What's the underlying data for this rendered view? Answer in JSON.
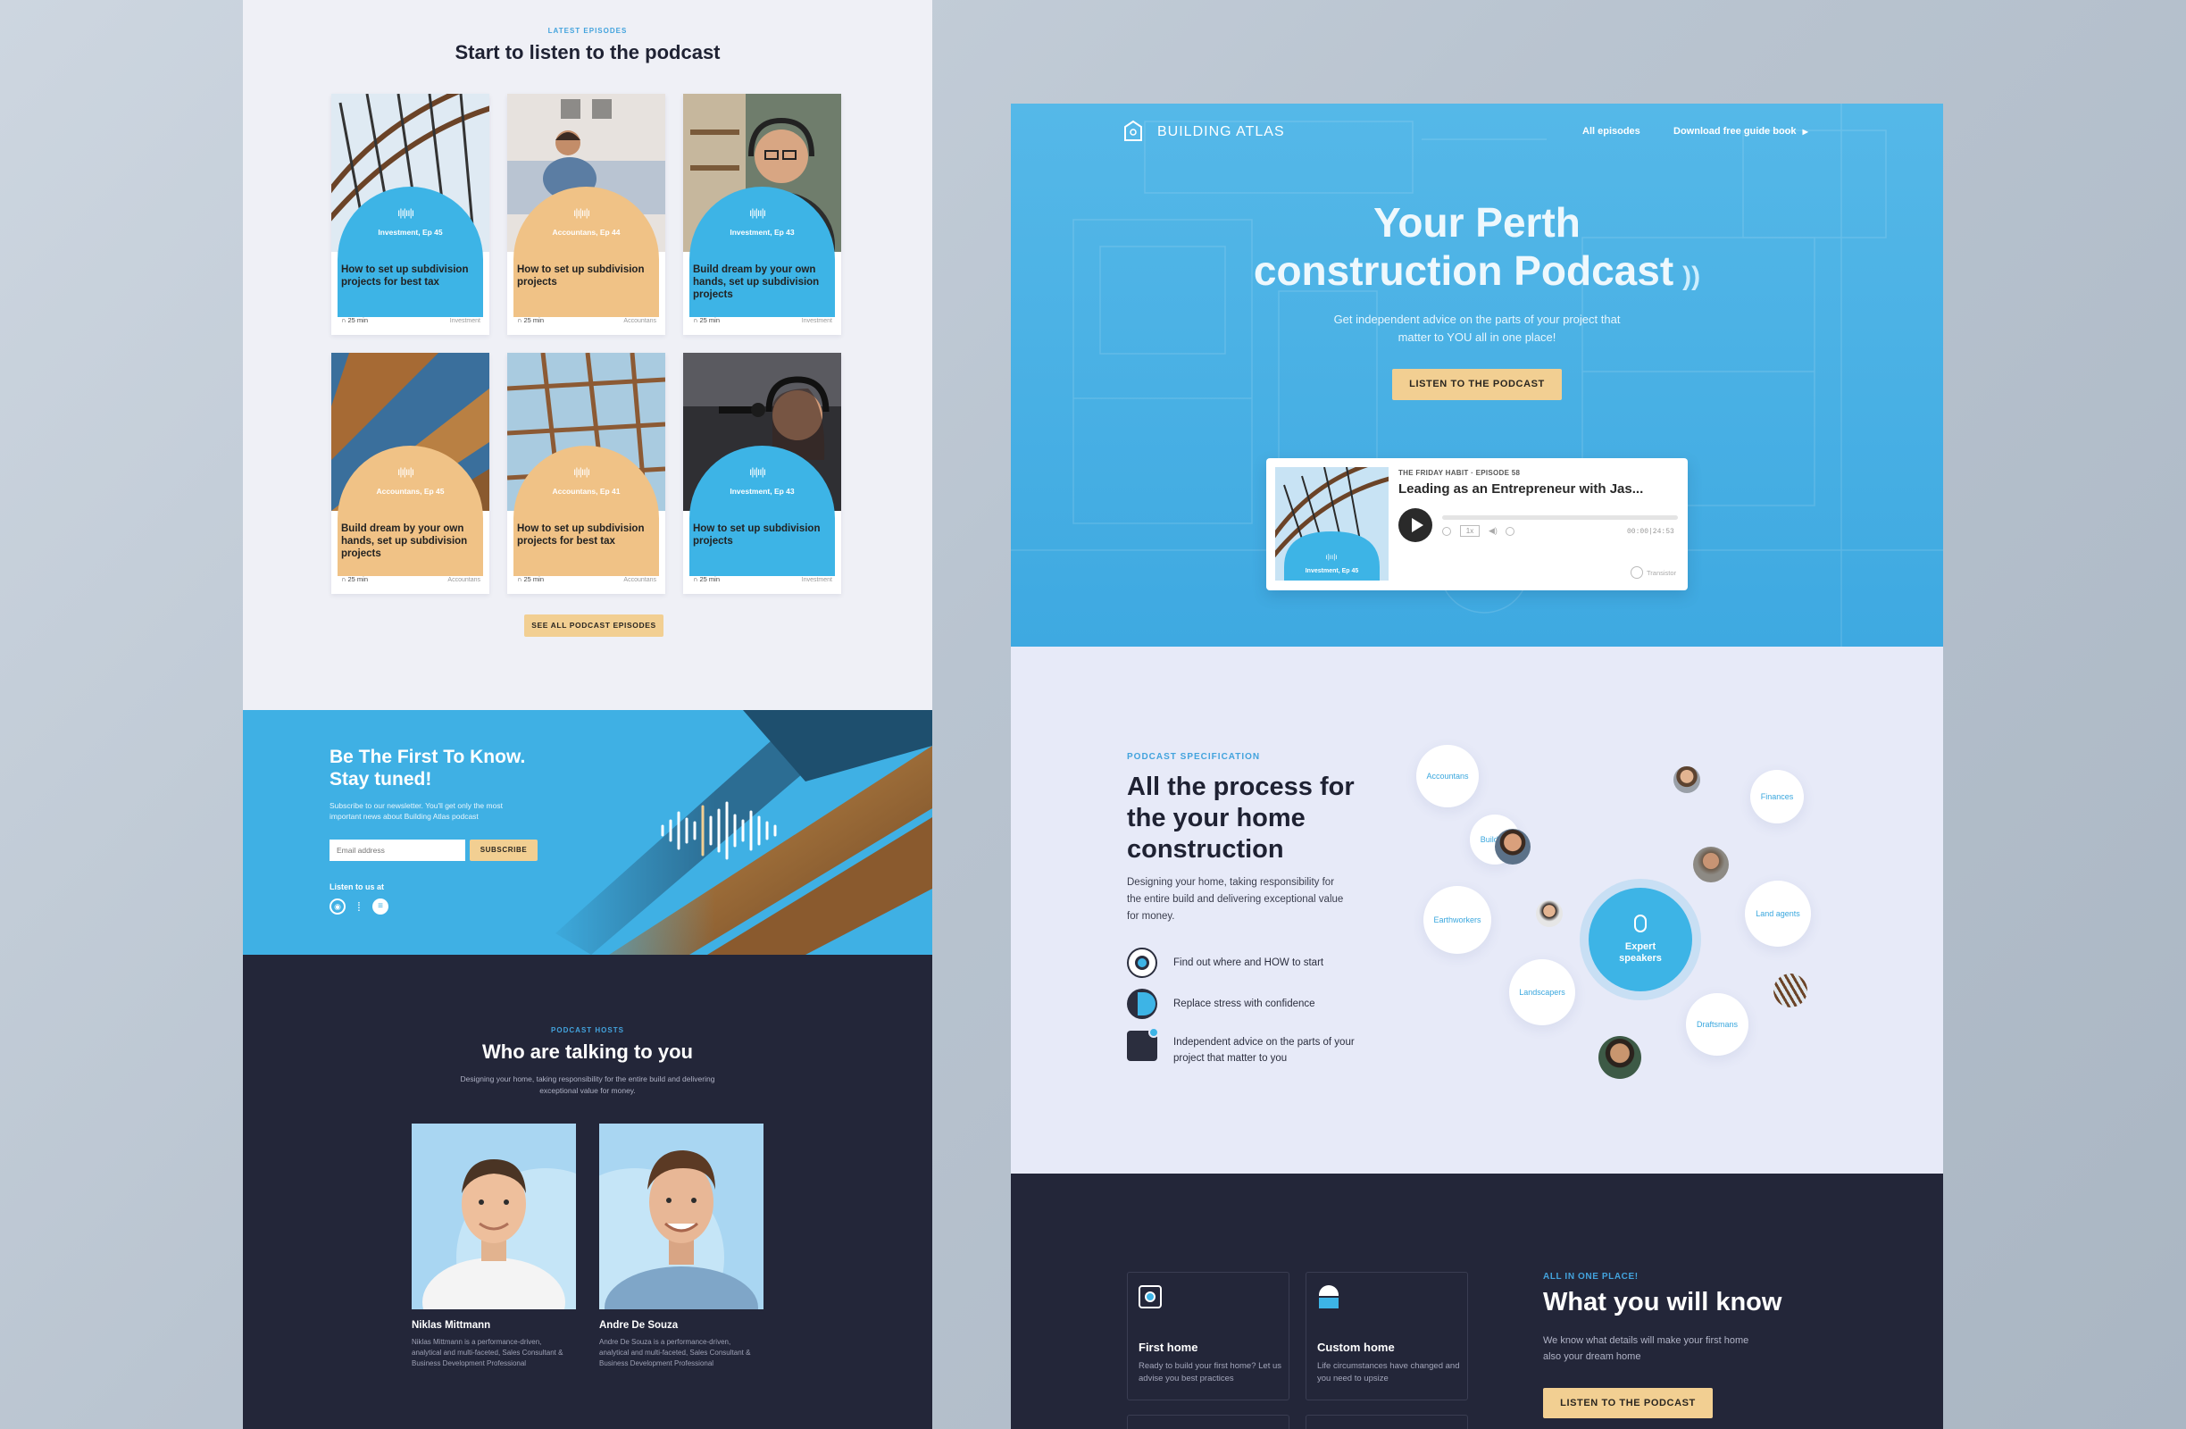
{
  "episodes_section": {
    "kicker": "LATEST EPISODES",
    "title": "Start to listen to the podcast",
    "cards": [
      {
        "tag": "Investment, Ep 45",
        "title": "How to set up subdivision projects for best tax",
        "duration": "25 min",
        "category": "Investment",
        "arch_color": "#3db4e6"
      },
      {
        "tag": "Accountans, Ep 44",
        "title": "How to set up subdivision projects",
        "duration": "25 min",
        "category": "Accountans",
        "arch_color": "#f0c286"
      },
      {
        "tag": "Investment, Ep 43",
        "title": "Build dream by your own hands, set up subdivision projects",
        "duration": "25 min",
        "category": "Investment",
        "arch_color": "#3db4e6"
      },
      {
        "tag": "Accountans, Ep 45",
        "title": "Build dream by your own hands, set up subdivision projects",
        "duration": "25 min",
        "category": "Accountans",
        "arch_color": "#f0c286"
      },
      {
        "tag": "Accountans, Ep 41",
        "title": "How to set up subdivision projects for best tax",
        "duration": "25 min",
        "category": "Accountans",
        "arch_color": "#f0c286"
      },
      {
        "tag": "Investment, Ep 43",
        "title": "How to set up subdivision projects",
        "duration": "25 min",
        "category": "Investment",
        "arch_color": "#3db4e6"
      }
    ],
    "see_all_label": "SEE ALL PODCAST EPISODES"
  },
  "newsletter": {
    "title_line1": "Be The First To Know.",
    "title_line2": "Stay tuned!",
    "description": "Subscribe to our newsletter. You'll get only the most important news about Building Atlas podcast",
    "email_placeholder": "Email address",
    "subscribe_label": "SUBSCRIBE",
    "listen_label": "Listen to us at",
    "platform_icons": [
      "apple-podcasts-icon",
      "google-podcasts-icon",
      "spotify-icon"
    ]
  },
  "hosts_section": {
    "kicker": "PODCAST HOSTS",
    "title": "Who are talking to you",
    "description": "Designing your home, taking responsibility for the entire build and delivering exceptional value for money.",
    "hosts": [
      {
        "name": "Niklas Mittmann",
        "bio": "Niklas Mittmann is a performance-driven, analytical and multi-faceted, Sales Consultant & Business Development Professional"
      },
      {
        "name": "Andre De Souza",
        "bio": "Andre De Souza is a performance-driven, analytical and multi-faceted, Sales Consultant & Business Development Professional"
      }
    ]
  },
  "hero": {
    "brand": "BUILDING ATLAS",
    "nav": {
      "all_episodes": "All episodes",
      "guide": "Download free guide book"
    },
    "title_line1": "Your Perth",
    "title_line2": "construction Podcast",
    "subtitle_line1": "Get independent advice on the parts of your project that",
    "subtitle_line2": "matter to YOU all in one place!",
    "cta_label": "LISTEN TO THE PODCAST",
    "player": {
      "show": "THE FRIDAY HABIT",
      "episode": "EPISODE 58",
      "title": "Leading as an Entrepreneur with Jas...",
      "time": "00:00|24:53",
      "speed": "1x",
      "cover_tag": "Investment, Ep 45",
      "transistor": "Transistor",
      "progress": 0
    }
  },
  "spec": {
    "kicker": "PODCAST SPECIFICATION",
    "title_line1": "All the process for",
    "title_line2": "the your home",
    "title_line3": "construction",
    "description": "Designing your home, taking responsibility for the entire build and delivering exceptional value for money.",
    "features": [
      "Find out where and HOW to start",
      "Replace stress with confidence",
      "Independent advice on the parts of your project that matter to you"
    ],
    "center": "Expert speakers",
    "bubbles": [
      "Accountans",
      "Finances",
      "Builders",
      "Earthworkers",
      "Land agents",
      "Landscapers",
      "Draftsmans"
    ]
  },
  "know": {
    "kicker": "ALL IN ONE PLACE!",
    "title": "What you will know",
    "description": "We know what details will make your first home also your dream home",
    "cta_label": "LISTEN TO THE PODCAST",
    "cards": [
      {
        "title": "First home",
        "description": "Ready to build your first home? Let us advise you best practices"
      },
      {
        "title": "Custom home",
        "description": "Life circumstances have changed and you need to upsize"
      }
    ]
  }
}
